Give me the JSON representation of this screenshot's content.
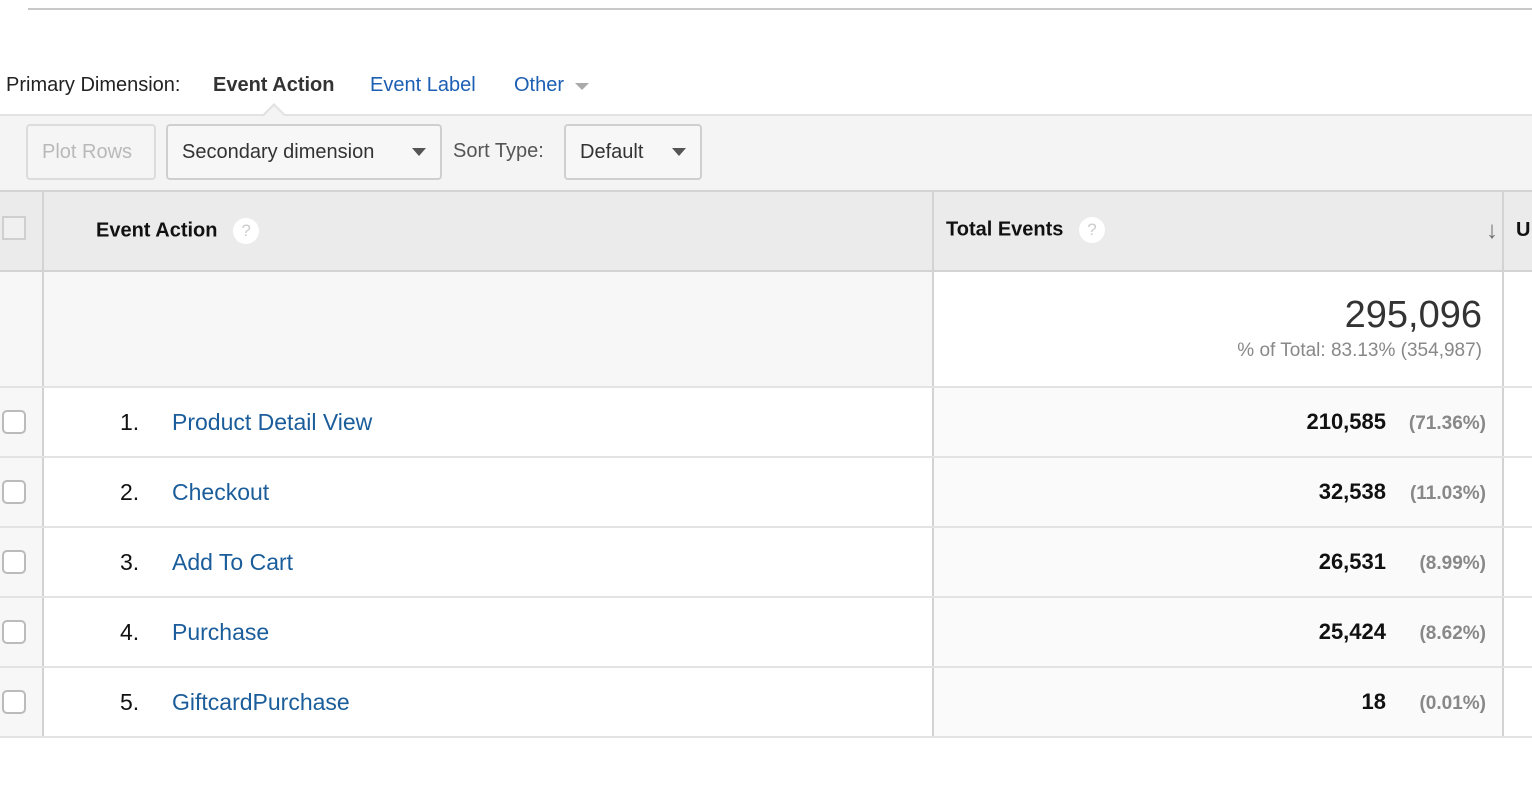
{
  "primary_dimension": {
    "label": "Primary Dimension:",
    "active": "Event Action",
    "options": [
      "Event Label",
      "Other"
    ]
  },
  "toolbar": {
    "plot_rows": "Plot Rows",
    "secondary_dimension": "Secondary dimension",
    "sort_type_label": "Sort Type:",
    "sort_type_value": "Default"
  },
  "table": {
    "columns": {
      "dimension": "Event Action",
      "metric": "Total Events",
      "next_partial": "U",
      "help_icon": "?",
      "sort_icon": "↓"
    },
    "summary": {
      "total": "295,096",
      "percent_of_total": "% of Total: 83.13% (354,987)"
    },
    "rows": [
      {
        "index": "1.",
        "label": "Product Detail View",
        "value": "210,585",
        "pct": "(71.36%)"
      },
      {
        "index": "2.",
        "label": "Checkout",
        "value": "32,538",
        "pct": "(11.03%)"
      },
      {
        "index": "3.",
        "label": "Add To Cart",
        "value": "26,531",
        "pct": "(8.99%)"
      },
      {
        "index": "4.",
        "label": "Purchase",
        "value": "25,424",
        "pct": "(8.62%)"
      },
      {
        "index": "5.",
        "label": "GiftcardPurchase",
        "value": "18",
        "pct": "(0.01%)"
      }
    ]
  }
}
